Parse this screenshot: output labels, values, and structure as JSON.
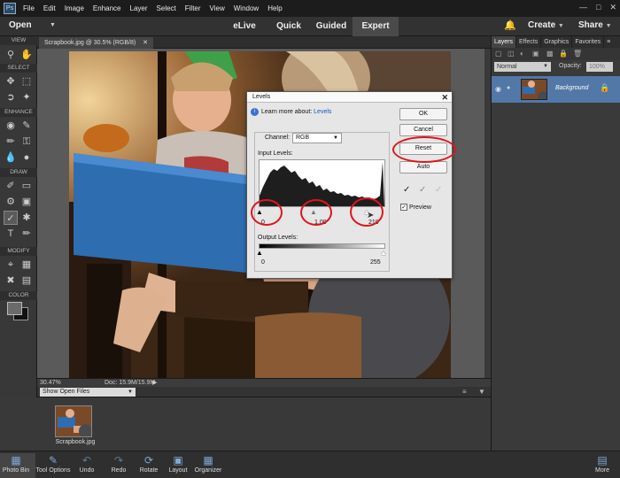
{
  "menubar": {
    "items": [
      "File",
      "Edit",
      "Image",
      "Enhance",
      "Layer",
      "Select",
      "Filter",
      "View",
      "Window",
      "Help"
    ]
  },
  "modebar": {
    "open_label": "Open",
    "modes": [
      "eLive",
      "Quick",
      "Guided",
      "Expert"
    ],
    "active_mode": "Expert",
    "create_label": "Create",
    "share_label": "Share"
  },
  "toolbar": {
    "sections": [
      "VIEW",
      "SELECT",
      "ENHANCE",
      "DRAW",
      "MODIFY",
      "COLOR"
    ]
  },
  "document": {
    "tab_label": "Scrapbook.jpg @ 30.5% (RGB/8)",
    "zoom": "30.47%",
    "doc_size": "Doc: 15.9M/15.9M"
  },
  "photo_bin": {
    "dropdown_label": "Show Open Files",
    "thumb_label": "Scrapbook.jpg"
  },
  "bottombar": {
    "items": [
      "Photo Bin",
      "Tool Options",
      "Undo",
      "Redo",
      "Rotate",
      "Layout",
      "Organizer"
    ],
    "more_label": "More"
  },
  "right_panel": {
    "tabs": [
      "Layers",
      "Effects",
      "Graphics",
      "Favorites"
    ],
    "active_tab": "Layers",
    "blend_mode": "Normal",
    "opacity_label": "Opacity:",
    "opacity_value": "100%",
    "layer_name": "Background"
  },
  "levels_dialog": {
    "title": "Levels",
    "learn_prefix": "Learn more about:",
    "learn_link": "Levels",
    "channel_label": "Channel:",
    "channel_value": "RGB",
    "input_levels_label": "Input Levels:",
    "input_values": [
      "0",
      "1.00",
      "210"
    ],
    "output_levels_label": "Output Levels:",
    "output_values": [
      "0",
      "255"
    ],
    "buttons": {
      "ok": "OK",
      "cancel": "Cancel",
      "reset": "Reset",
      "auto": "Auto"
    },
    "preview_label": "Preview",
    "preview_checked": true
  },
  "colors": {
    "accent_blue": "#3d8be0",
    "annotation_red": "#e0141e",
    "layer_selected": "#5278a8"
  }
}
